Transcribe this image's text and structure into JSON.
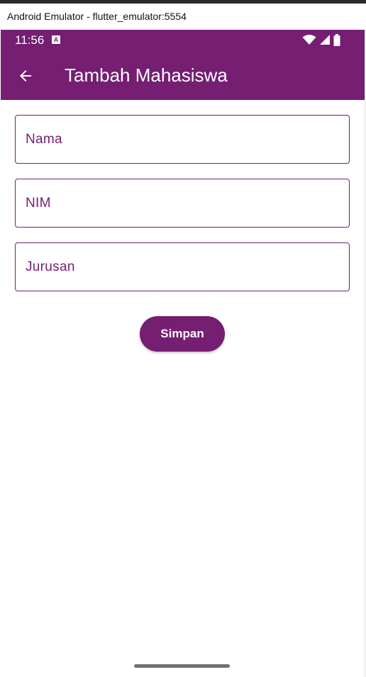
{
  "window": {
    "title": "Android Emulator - flutter_emulator:5554"
  },
  "status_bar": {
    "time": "11:56",
    "icons": [
      "android-notification-icon",
      "wifi-icon",
      "cellular-signal-icon",
      "battery-icon"
    ]
  },
  "app_bar": {
    "title": "Tambah Mahasiswa",
    "back_icon": "arrow-back-icon"
  },
  "form": {
    "fields": [
      {
        "name": "nama",
        "placeholder": "Nama",
        "value": ""
      },
      {
        "name": "nim",
        "placeholder": "NIM",
        "value": ""
      },
      {
        "name": "jurusan",
        "placeholder": "Jurusan",
        "value": ""
      }
    ],
    "submit_label": "Simpan"
  },
  "colors": {
    "primary": "#751e72",
    "on_primary": "#ffffff",
    "background": "#ffffff",
    "nav_handle": "#707070"
  }
}
